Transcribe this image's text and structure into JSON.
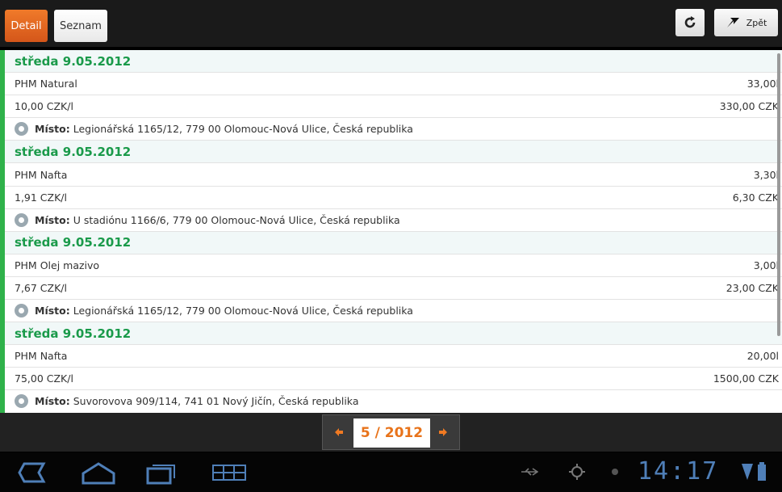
{
  "tabs": [
    {
      "label": "Detail",
      "active": true
    },
    {
      "label": "Seznam",
      "active": false
    }
  ],
  "toolbar": {
    "back_label": "Zpět",
    "refresh_icon": "refresh-icon",
    "back_icon": "arrow-back-icon"
  },
  "entries": [
    {
      "date": "středa 9.05.2012",
      "item": "PHM Natural",
      "quantity": "33,00l",
      "unit_price": "10,00 CZK/l",
      "total": "330,00 CZK",
      "place_label": "Místo:",
      "place": "Legionářská 1165/12, 779 00 Olomouc-Nová Ulice, Česká republika"
    },
    {
      "date": "středa 9.05.2012",
      "item": "PHM Nafta",
      "quantity": "3,30l",
      "unit_price": "1,91 CZK/l",
      "total": "6,30 CZK",
      "place_label": "Místo:",
      "place": "U stadiónu 1166/6, 779 00 Olomouc-Nová Ulice, Česká republika"
    },
    {
      "date": "středa 9.05.2012",
      "item": "PHM Olej mazivo",
      "quantity": "3,00l",
      "unit_price": "7,67 CZK/l",
      "total": "23,00 CZK",
      "place_label": "Místo:",
      "place": "Legionářská 1165/12, 779 00 Olomouc-Nová Ulice, Česká republika"
    },
    {
      "date": "středa 9.05.2012",
      "item": "PHM Nafta",
      "quantity": "20,00l",
      "unit_price": "75,00 CZK/l",
      "total": "1500,00 CZK",
      "place_label": "Místo:",
      "place": "Suvorovova 909/114, 741 01 Nový Jičín, Česká republika"
    }
  ],
  "pager": {
    "value": "5 / 2012"
  },
  "statusbar": {
    "time": "14:17"
  },
  "colors": {
    "accent": "#e8731a",
    "date_green": "#1a9a4a",
    "list_border": "#2fb24a",
    "clock": "#4f7fb8"
  }
}
